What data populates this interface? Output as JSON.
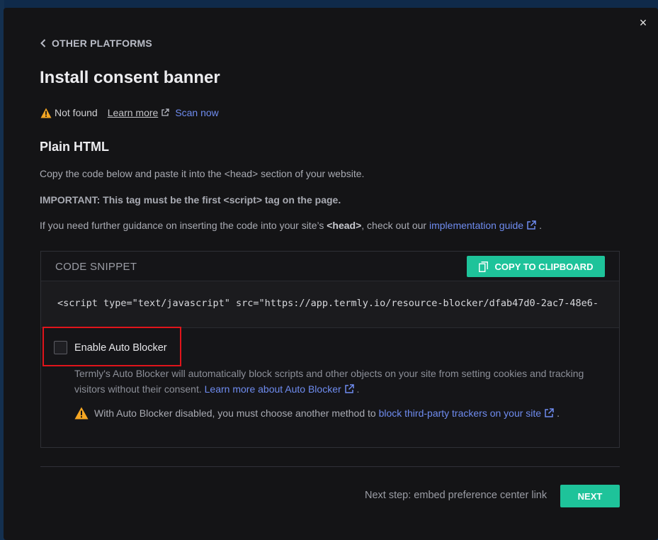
{
  "modal": {
    "close_label": "×",
    "back_label": "OTHER PLATFORMS",
    "title": "Install consent banner"
  },
  "status": {
    "text": "Not found",
    "learn_more": "Learn more",
    "scan_now": "Scan now"
  },
  "section": {
    "subtitle": "Plain HTML",
    "instruction": "Copy the code below and paste it into the <head> section of your website.",
    "important": "IMPORTANT: This tag must be the first <script> tag on the page.",
    "guidance_prefix": "If you need further guidance on inserting the code into your site’s ",
    "guidance_bold": "<head>",
    "guidance_middle": ", check out our ",
    "guidance_link": "implementation guide",
    "guidance_suffix": "."
  },
  "snippet": {
    "label": "CODE SNIPPET",
    "copy_button": "COPY TO CLIPBOARD",
    "code": "<script type=\"text/javascript\" src=\"https://app.termly.io/resource-blocker/dfab47d0-2ac7-48e6-"
  },
  "auto_blocker": {
    "checkbox_label": "Enable Auto Blocker",
    "checked": false,
    "description": "Termly's Auto Blocker will automatically block scripts and other objects on your site from setting cookies and tracking visitors without their consent. ",
    "learn_more_link": "Learn more about Auto Blocker",
    "desc_suffix": ".",
    "warning_prefix": "With Auto Blocker disabled, you must choose another method to ",
    "warning_link": "block third-party trackers on your site",
    "warning_suffix": "."
  },
  "footer": {
    "next_step_text": "Next step: embed preference center link",
    "next_button": "NEXT"
  },
  "colors": {
    "accent_green": "#1ec39a",
    "link_blue": "#6f8cf0",
    "warning_orange": "#f5a623",
    "highlight_red": "#e0141b"
  }
}
